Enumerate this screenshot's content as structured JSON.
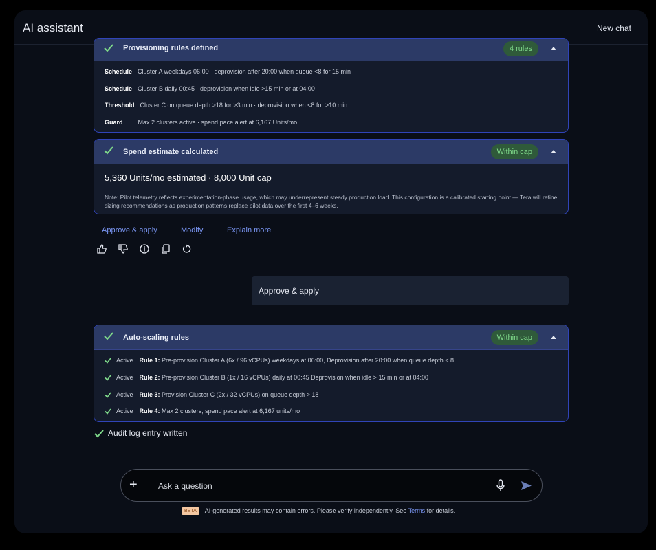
{
  "header": {
    "title": "AI assistant",
    "new_chat": "New chat"
  },
  "provisioning": {
    "title": "Provisioning rules defined",
    "badge": "4 rules",
    "rows": [
      {
        "label": "Schedule",
        "text": "Cluster A weekdays 06:00 · deprovision after 20:00 when queue <8 for 15 min"
      },
      {
        "label": "Schedule",
        "text": "Cluster B daily 00:45 · deprovision when idle >15 min or at 04:00"
      },
      {
        "label": "Threshold",
        "text": "Cluster C on queue depth >18 for >3 min · deprovision when <8 for >10 min"
      },
      {
        "label": "Guard",
        "text": "Max 2 clusters active · spend pace alert at 6,167 Units/mo"
      }
    ]
  },
  "spend": {
    "title": "Spend estimate calculated",
    "badge": "Within cap",
    "headline": "5,360 Units/mo estimated · 8,000 Unit cap",
    "note": "Note: Pilot telemetry reflects experimentation-phase usage, which may underrepresent steady production load. This configuration is a calibrated starting point — Tera will refine sizing recommendations as production patterns replace pilot data over the first 4–6 weeks."
  },
  "actions": {
    "approve": "Approve & apply",
    "modify": "Modify",
    "explain": "Explain more"
  },
  "user_message": "Approve & apply",
  "autoscaling": {
    "title": "Auto-scaling rules",
    "badge": "Within cap",
    "rules": [
      {
        "status": "Active",
        "name": "Rule 1:",
        "text": "Pre-provision Cluster A (6x / 96 vCPUs) weekdays at 06:00, Deprovision after 20:00 when queue depth < 8"
      },
      {
        "status": "Active",
        "name": "Rule 2:",
        "text": "Pre-provision Cluster B (1x / 16 vCPUs) daily at 00:45 Deprovision when idle > 15 min or at 04:00"
      },
      {
        "status": "Active",
        "name": "Rule 3:",
        "text": "Provision Cluster C (2x / 32 vCPUs) on queue depth > 18"
      },
      {
        "status": "Active",
        "name": "Rule 4:",
        "text": "Max 2 clusters; spend pace alert at 6,167 units/mo"
      }
    ]
  },
  "audit": "Audit log entry written",
  "input": {
    "placeholder": "Ask a question"
  },
  "disclaimer": {
    "beta": "BETA",
    "text": "AI-generated results may contain errors. Please verify independently. See",
    "terms": "Terms",
    "suffix": "for details."
  },
  "colors": {
    "accent": "#7b97f5",
    "success": "#7fd98a",
    "card_border": "#3044b8"
  }
}
